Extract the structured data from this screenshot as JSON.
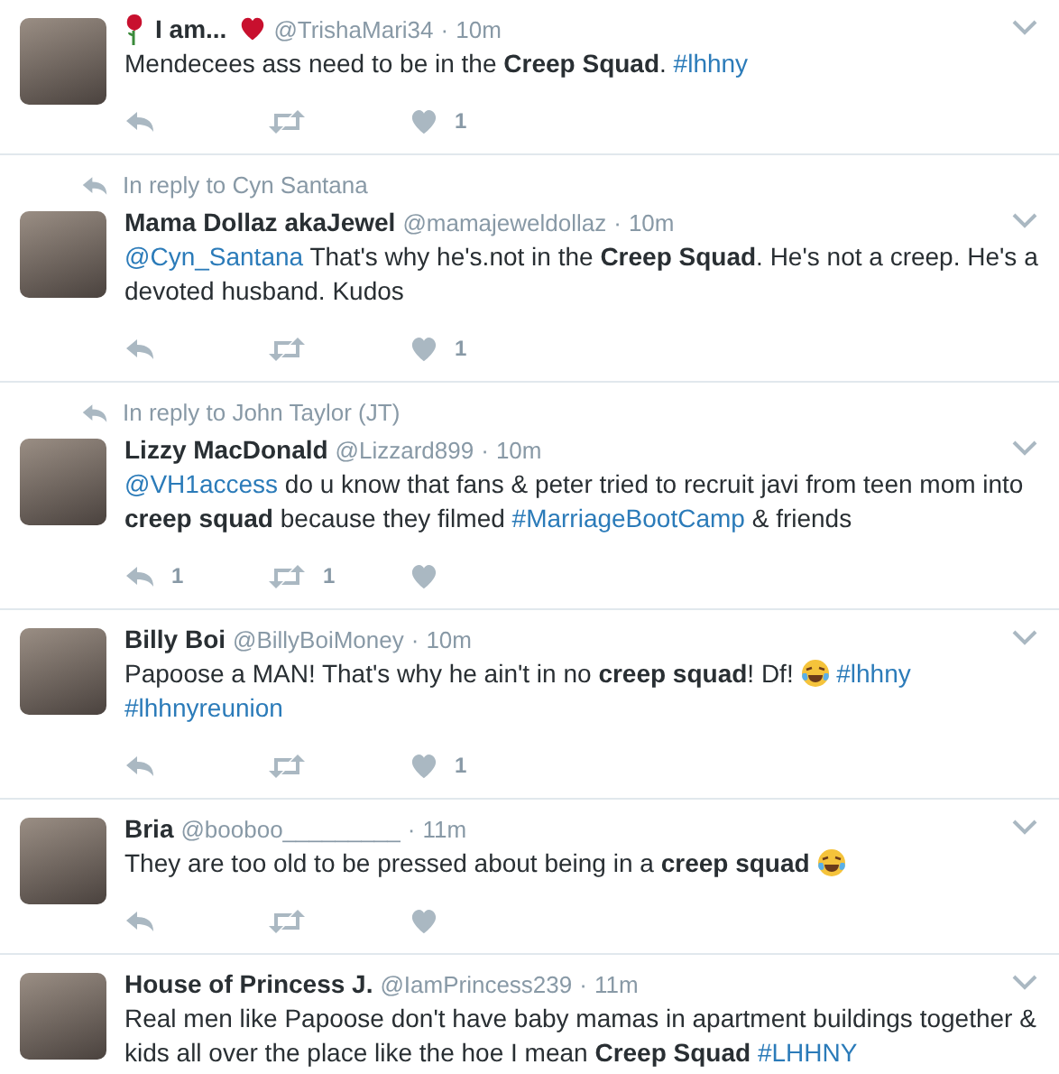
{
  "tweets": [
    {
      "name": [
        {
          "kind": "rose"
        },
        {
          "kind": "text",
          "text": "I am..."
        },
        {
          "kind": "heart"
        }
      ],
      "handle": "@TrishaMari34",
      "separator": "·",
      "time": "10m",
      "text": [
        {
          "kind": "text",
          "text": "Mendecees ass need to be in the **Creep Squad**. "
        },
        {
          "kind": "hashtag",
          "text": "#lhhny"
        }
      ],
      "actions": [
        {
          "kind": "reply"
        },
        {
          "kind": "retweet"
        },
        {
          "kind": "like",
          "count": "1"
        }
      ]
    },
    {
      "reply_to": "In reply to Cyn Santana",
      "name": [
        {
          "kind": "text",
          "text": "Mama Dollaz akaJewel"
        }
      ],
      "handle": "@mamajeweldollaz",
      "separator": "·",
      "time": "10m",
      "text": [
        {
          "kind": "mention",
          "text": "@Cyn_Santana"
        },
        {
          "kind": "text",
          "text": " That's why he's.not in the **Creep Squad**. He's not a creep. He's a devoted husband. Kudos"
        }
      ],
      "actions": [
        {
          "kind": "reply"
        },
        {
          "kind": "retweet"
        },
        {
          "kind": "like",
          "count": "1"
        }
      ]
    },
    {
      "reply_to": "In reply to John Taylor (JT)",
      "name": [
        {
          "kind": "text",
          "text": "Lizzy MacDonald"
        }
      ],
      "handle": "@Lizzard899",
      "separator": "·",
      "time": "10m",
      "text": [
        {
          "kind": "mention",
          "text": "@VH1access"
        },
        {
          "kind": "text",
          "text": " do u know that fans & peter tried to recruit javi from teen mom into **creep squad** because they filmed "
        },
        {
          "kind": "hashtag",
          "text": "#MarriageBootCamp"
        },
        {
          "kind": "text",
          "text": " & friends"
        }
      ],
      "actions": [
        {
          "kind": "reply",
          "count": "1"
        },
        {
          "kind": "retweet",
          "count": "1"
        },
        {
          "kind": "like"
        }
      ]
    },
    {
      "name": [
        {
          "kind": "text",
          "text": "Billy Boi"
        }
      ],
      "handle": "@BillyBoiMoney",
      "separator": "·",
      "time": "10m",
      "text": [
        {
          "kind": "text",
          "text": "Papoose a MAN! That's why he ain't in no **creep squad**! Df! "
        },
        {
          "kind": "emoji"
        },
        {
          "kind": "hashtag",
          "text": "#lhhny"
        },
        {
          "kind": "hashtag",
          "text": "#lhhnyreunion"
        }
      ],
      "actions": [
        {
          "kind": "reply"
        },
        {
          "kind": "retweet"
        },
        {
          "kind": "like",
          "count": "1"
        }
      ]
    },
    {
      "name": [
        {
          "kind": "text",
          "text": "Bria"
        }
      ],
      "handle": "@booboo_________",
      "separator": "·",
      "time": "11m",
      "text": [
        {
          "kind": "text",
          "text": "They are too old to be pressed about being in a **creep squad** "
        },
        {
          "kind": "emoji"
        }
      ],
      "actions": [
        {
          "kind": "reply"
        },
        {
          "kind": "retweet"
        },
        {
          "kind": "like"
        }
      ]
    },
    {
      "name": [
        {
          "kind": "text",
          "text": "House of Princess J."
        }
      ],
      "handle": "@IamPrincess239",
      "separator": "·",
      "time": "11m",
      "text": [
        {
          "kind": "text",
          "text": "Real men like Papoose don't have baby mamas in apartment buildings together & kids all over the place like the hoe I mean **Creep Squad** "
        },
        {
          "kind": "hashtag",
          "text": "#LHHNY"
        }
      ]
    }
  ]
}
